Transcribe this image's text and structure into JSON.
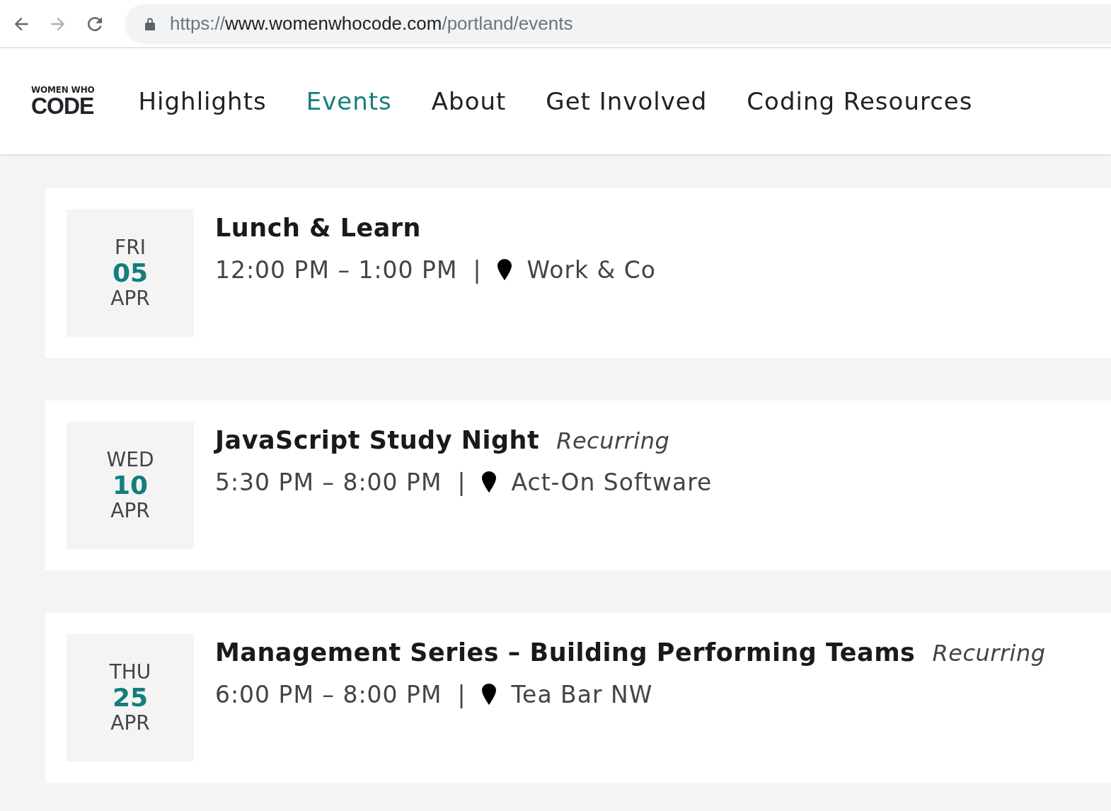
{
  "browser": {
    "url": {
      "scheme": "https://",
      "host": "www.womenwhocode.com",
      "path": "/portland/events"
    },
    "forward_disabled": true
  },
  "logo": {
    "top": "WOMEN WHO",
    "bottom": "CODE"
  },
  "nav": [
    {
      "label": "Highlights",
      "selected": false
    },
    {
      "label": "Events",
      "selected": true
    },
    {
      "label": "About",
      "selected": false
    },
    {
      "label": "Get Involved",
      "selected": false
    },
    {
      "label": "Coding Resources",
      "selected": false
    }
  ],
  "events": [
    {
      "weekday": "FRI",
      "day": "05",
      "month": "APR",
      "title": "Lunch & Learn",
      "time": "12:00 PM – 1:00 PM",
      "separator": "|",
      "venue": "Work & Co"
    },
    {
      "weekday": "WED",
      "day": "10",
      "month": "APR",
      "title": "JavaScript Study Night",
      "tag": "Recurring",
      "time": "5:30 PM – 8:00 PM",
      "separator": "|",
      "venue": "Act-On Software"
    },
    {
      "weekday": "THU",
      "day": "25",
      "month": "APR",
      "title": "Management Series – Building Performing Teams",
      "tag": "Recurring",
      "time": "6:00 PM – 8:00 PM",
      "separator": "|",
      "venue": "Tea Bar NW"
    }
  ]
}
